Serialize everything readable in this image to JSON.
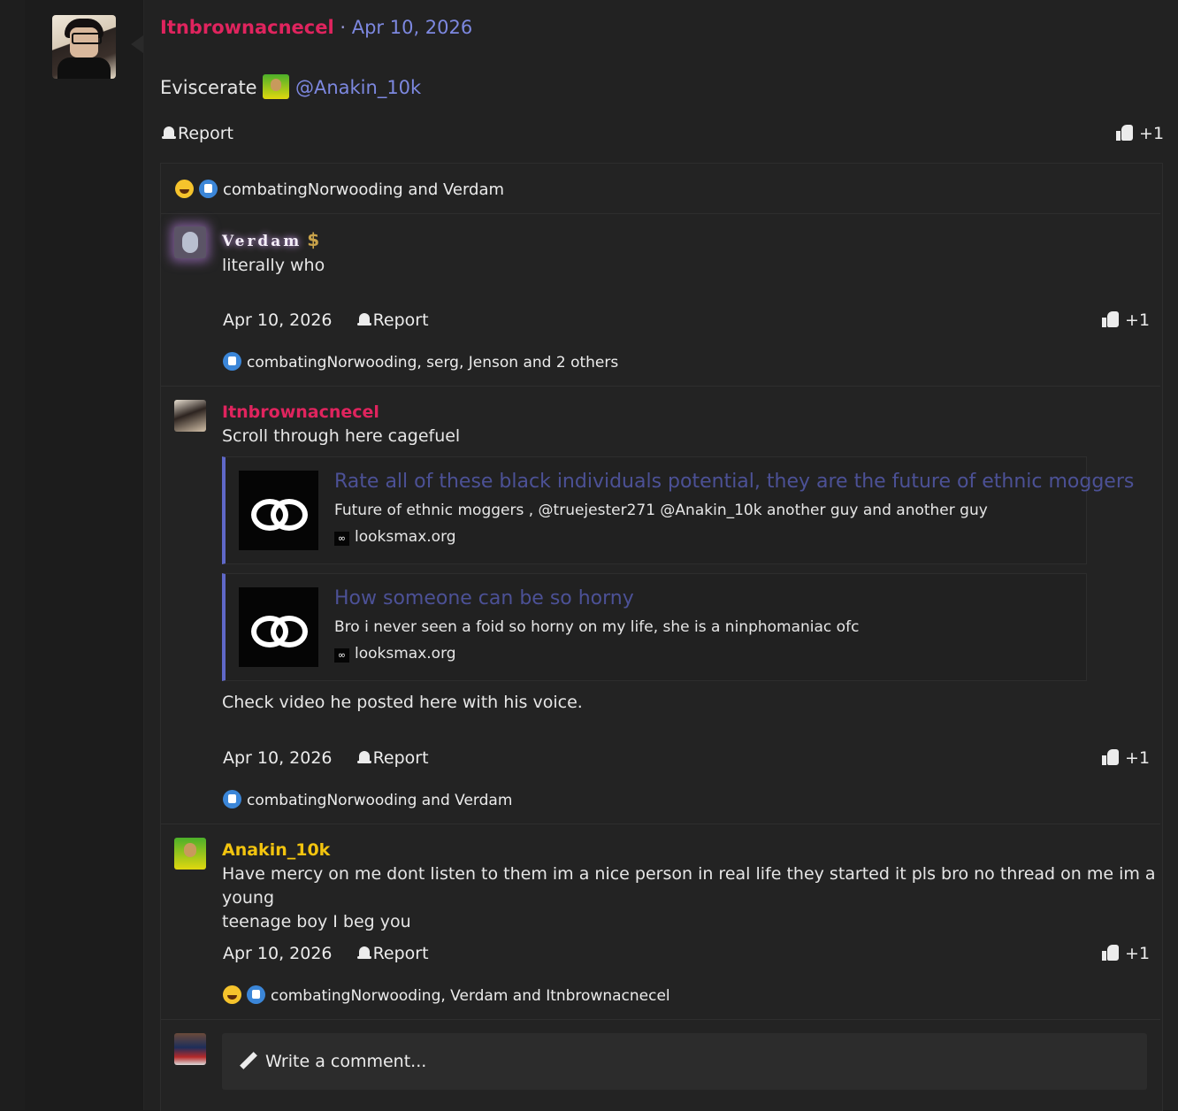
{
  "post": {
    "author": "Itnbrownacnecel",
    "separator": "·",
    "date": "Apr 10, 2026",
    "body_text": "Eviscerate",
    "mention": "@Anakin_10k",
    "report_label": "Report",
    "like_label": "+1",
    "reactions_summary": "combatingNorwooding and Verdam"
  },
  "comments": [
    {
      "author": "Verdam",
      "badge": "$",
      "text": "literally who",
      "date": "Apr 10, 2026",
      "report_label": "Report",
      "like_label": "+1",
      "reactions_summary": "combatingNorwooding, serg, Jenson and 2 others"
    },
    {
      "author": "Itnbrownacnecel",
      "text": "Scroll through here cagefuel",
      "links": [
        {
          "title": "Rate all of these black individuals potential, they are the future of ethnic moggers",
          "description": "Future of ethnic moggers , @truejester271 @Anakin_10k another guy and another guy",
          "favicon": "∞",
          "site": "looksmax.org"
        },
        {
          "title": "How someone can be so horny",
          "description": "Bro i never seen a foid so horny on my life, she is a ninphomaniac ofc",
          "favicon": "∞",
          "site": "looksmax.org"
        }
      ],
      "text_after": "Check video he posted here with his voice.",
      "date": "Apr 10, 2026",
      "report_label": "Report",
      "like_label": "+1",
      "reactions_summary": "combatingNorwooding and Verdam"
    },
    {
      "author": "Anakin_10k",
      "text_line1": "Have mercy on me dont listen to them im a nice person in real life they started it pls bro no thread on me im a young",
      "text_line2": "teenage boy I beg you",
      "date": "Apr 10, 2026",
      "report_label": "Report",
      "like_label": "+1",
      "reactions_summary": "combatingNorwooding, Verdam and Itnbrownacnecel"
    }
  ],
  "composer": {
    "placeholder": "Write a comment..."
  },
  "colors": {
    "author_red": "#e0245e",
    "link_blue": "#7d88e0",
    "gold_name": "#f2c40f",
    "card_accent": "#5f68c8"
  },
  "icons": [
    "bell-icon",
    "thumbs-up-icon",
    "laugh-emoji-icon",
    "like-reaction-icon",
    "pencil-icon"
  ]
}
